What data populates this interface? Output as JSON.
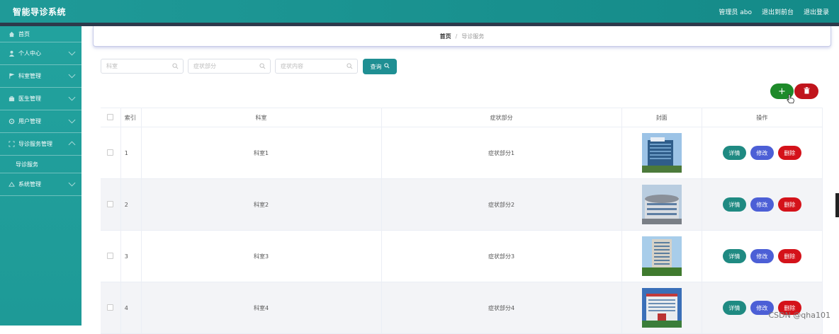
{
  "header": {
    "app_title": "智能导诊系统",
    "user_label": "管理员 abo",
    "back_to_admin": "退出到前台",
    "logout": "退出登录"
  },
  "sidebar": {
    "items": [
      {
        "label": "首页",
        "icon": "home-icon"
      },
      {
        "label": "个人中心",
        "icon": "user-icon"
      },
      {
        "label": "科室管理",
        "icon": "flag-icon"
      },
      {
        "label": "医生管理",
        "icon": "briefcase-icon"
      },
      {
        "label": "用户管理",
        "icon": "gear-icon"
      },
      {
        "label": "导诊服务管理",
        "icon": "expand-icon"
      },
      {
        "label": "导诊服务",
        "icon": ""
      },
      {
        "label": "系统管理",
        "icon": "settings-icon"
      }
    ]
  },
  "breadcrumb": {
    "home": "首页",
    "separator": "/",
    "current": "导诊服务"
  },
  "search": {
    "dept_placeholder": "科室",
    "symptom_placeholder": "症状部分",
    "content_placeholder": "症状内容",
    "query_label": "查询"
  },
  "table": {
    "headers": [
      "索引",
      "科室",
      "症状部分",
      "封面",
      "操作"
    ],
    "rows": [
      {
        "index": "1",
        "dept": "科室1",
        "symptom": "症状部分1"
      },
      {
        "index": "2",
        "dept": "科室2",
        "symptom": "症状部分2"
      },
      {
        "index": "3",
        "dept": "科室3",
        "symptom": "症状部分3"
      },
      {
        "index": "4",
        "dept": "科室4",
        "symptom": "症状部分4"
      }
    ],
    "actions": {
      "detail": "详情",
      "edit": "修改",
      "delete": "删除"
    }
  },
  "toolbar": {
    "add_symbol": "+"
  },
  "watermark": "CSDN @qha101",
  "colors": {
    "primary": "#1f9a98",
    "add": "#1e8a2a",
    "danger": "#c0141c",
    "edit": "#4c5fd6"
  }
}
